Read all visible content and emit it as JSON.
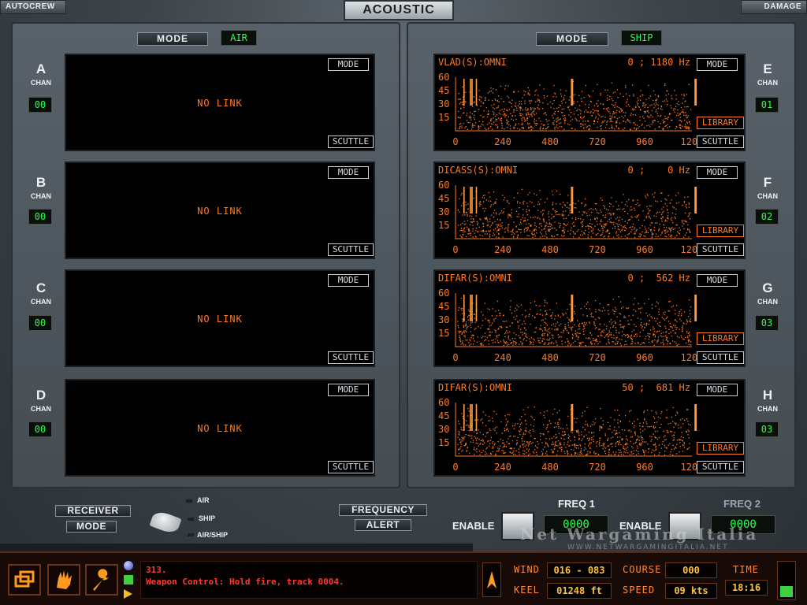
{
  "header": {
    "autocrew": "AUTOCREW",
    "title": "ACOUSTIC",
    "damage": "DAMAGE"
  },
  "left": {
    "mode_label": "MODE",
    "mode_value": "AIR",
    "channels": [
      {
        "letter": "A",
        "chan": "CHAN",
        "num": "00",
        "status": "NO LINK",
        "mode": "MODE",
        "scuttle": "SCUTTLE"
      },
      {
        "letter": "B",
        "chan": "CHAN",
        "num": "00",
        "status": "NO LINK",
        "mode": "MODE",
        "scuttle": "SCUTTLE"
      },
      {
        "letter": "C",
        "chan": "CHAN",
        "num": "00",
        "status": "NO LINK",
        "mode": "MODE",
        "scuttle": "SCUTTLE"
      },
      {
        "letter": "D",
        "chan": "CHAN",
        "num": "00",
        "status": "NO LINK",
        "mode": "MODE",
        "scuttle": "SCUTTLE"
      }
    ]
  },
  "right": {
    "mode_label": "MODE",
    "mode_value": "SHIP",
    "channels": [
      {
        "letter": "E",
        "chan": "CHAN",
        "num": "01",
        "sensor": "VLAD(S):OMNI",
        "freq": "0 ; 1180 Hz",
        "mode": "MODE",
        "library": "LIBRARY",
        "scuttle": "SCUTTLE"
      },
      {
        "letter": "F",
        "chan": "CHAN",
        "num": "02",
        "sensor": "DICASS(S):OMNI",
        "freq": "0 ;    0 Hz",
        "mode": "MODE",
        "library": "LIBRARY",
        "scuttle": "SCUTTLE"
      },
      {
        "letter": "G",
        "chan": "CHAN",
        "num": "03",
        "sensor": "DIFAR(S):OMNI",
        "freq": "0 ;  562 Hz",
        "mode": "MODE",
        "library": "LIBRARY",
        "scuttle": "SCUTTLE"
      },
      {
        "letter": "H",
        "chan": "CHAN",
        "num": "03",
        "sensor": "DIFAR(S):OMNI",
        "freq": "50 ;  681 Hz",
        "mode": "MODE",
        "library": "LIBRARY",
        "scuttle": "SCUTTLE"
      }
    ],
    "y_ticks": [
      "60",
      "45",
      "30",
      "15"
    ],
    "x_ticks": [
      "0",
      "240",
      "480",
      "720",
      "960",
      "1200"
    ],
    "line_positions": [
      0,
      12,
      15,
      23,
      200,
      202,
      430,
      432
    ]
  },
  "controls": {
    "receiver": "RECEIVER",
    "mode": "MODE",
    "air": "AIR",
    "ship": "SHIP",
    "air_ship": "AIR/SHIP",
    "frequency": "FREQUENCY",
    "alert": "ALERT",
    "freq1": "FREQ 1",
    "freq2": "FREQ 2",
    "enable1": "ENABLE",
    "enable2": "ENABLE",
    "freq1_val": "0000",
    "freq2_val": "0000"
  },
  "status": {
    "msg1": "313.",
    "msg2": "Weapon Control: Hold fire, track 0004.",
    "wind_label": "WIND",
    "wind": "016 - 083",
    "course_label": "COURSE",
    "course": "000",
    "time_label": "TIME",
    "time": "18:16",
    "keel_label": "KEEL",
    "keel": "01248 ft",
    "speed_label": "SPEED",
    "speed": "09 kts"
  },
  "watermark": {
    "main": "Net Wargaming Italia",
    "sub": "WWW.NETWARGAMINGITALIA.NET"
  },
  "colors": {
    "accent": "#ff7a20",
    "green": "#2dff4a",
    "amber": "#ffc23a"
  }
}
